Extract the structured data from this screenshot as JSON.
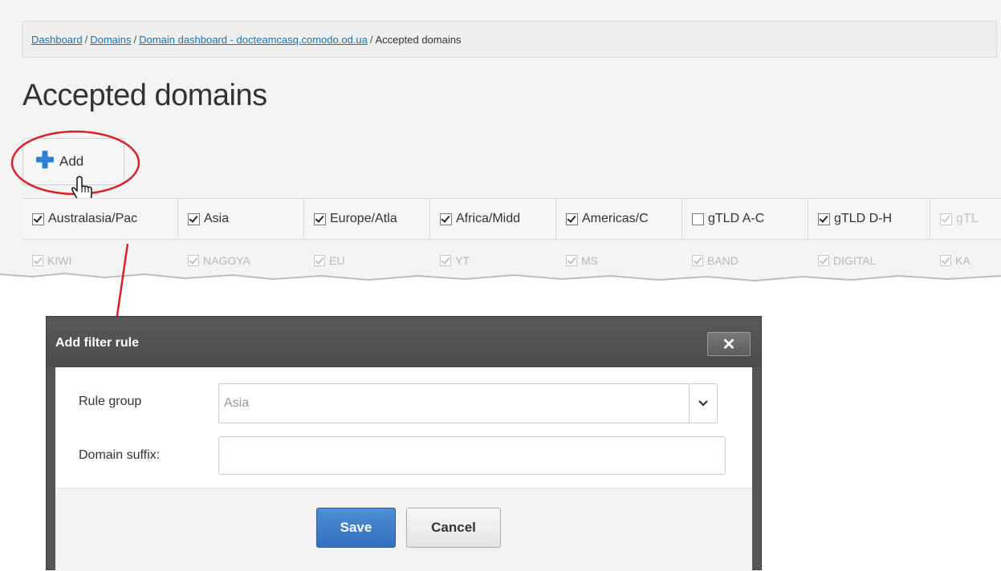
{
  "breadcrumb": {
    "items": [
      {
        "label": "Dashboard",
        "link": true
      },
      {
        "label": "Domains",
        "link": true
      },
      {
        "label": "Domain dashboard - docteamcasq.comodo.od.ua",
        "link": true
      },
      {
        "label": "Accepted domains",
        "link": false
      }
    ],
    "separator": "/"
  },
  "page": {
    "title": "Accepted domains"
  },
  "toolbar": {
    "add_label": "Add",
    "add_icon": "plus-icon",
    "accent": "#2f7fd1"
  },
  "annotation": {
    "highlight_color": "#d8212c"
  },
  "rule_groups": [
    {
      "label": "Australasia/Pac",
      "checked": true
    },
    {
      "label": "Asia",
      "checked": true
    },
    {
      "label": "Europe/Atla",
      "checked": true
    },
    {
      "label": "Africa/Midd",
      "checked": true
    },
    {
      "label": "Americas/C",
      "checked": true
    },
    {
      "label": "gTLD A-C",
      "checked": false
    },
    {
      "label": "gTLD D-H",
      "checked": true
    },
    {
      "label": "gTL",
      "checked": true
    }
  ],
  "rule_tags": [
    "KIWI",
    "NAGOYA",
    "EU",
    "YT",
    "MS",
    "BAND",
    "DIGITAL",
    "KA"
  ],
  "dialog": {
    "title": "Add filter rule",
    "close_label": "✕",
    "rule_group_label": "Rule group",
    "rule_group_value": "Asia",
    "domain_suffix_label": "Domain suffix:",
    "domain_suffix_value": "",
    "save_label": "Save",
    "cancel_label": "Cancel",
    "save_color": "#3a7cc8"
  }
}
